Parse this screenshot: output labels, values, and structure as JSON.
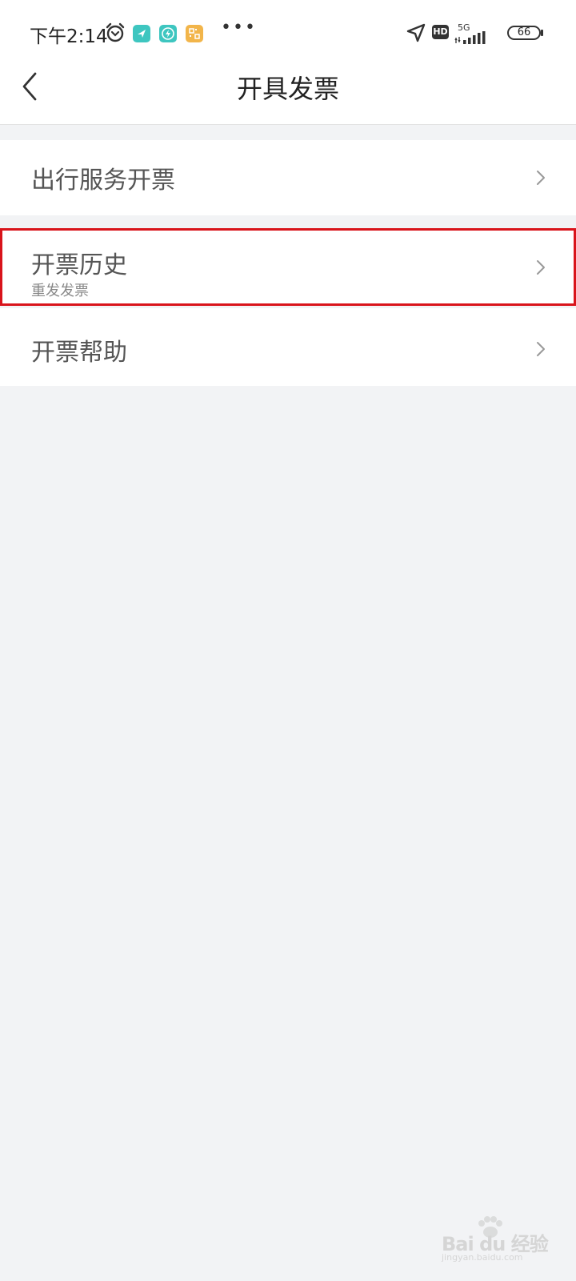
{
  "status_bar": {
    "time": "下午2:14",
    "network": "5G",
    "hd_label": "HD",
    "battery": "66",
    "more": "•••",
    "icons": [
      "alarm-icon",
      "app-send-icon",
      "app-bolt-icon",
      "app-qr-icon",
      "location-arrow-icon",
      "signal-icon"
    ]
  },
  "header": {
    "title": "开具发票",
    "back_icon": "chevron-left-icon"
  },
  "list": {
    "items": [
      {
        "label": "出行服务开票",
        "sub": ""
      },
      {
        "label": "开票历史",
        "sub": "重发发票"
      },
      {
        "label": "开票帮助",
        "sub": ""
      }
    ]
  },
  "watermark": {
    "brand": "Bai du 经验",
    "url": "jingyan.baidu.com"
  },
  "colors": {
    "highlight_border": "#d9141b",
    "background": "#f2f3f5",
    "row_bg": "#ffffff",
    "app_teal": "#3ec6c0",
    "app_orange": "#f2b54a"
  }
}
